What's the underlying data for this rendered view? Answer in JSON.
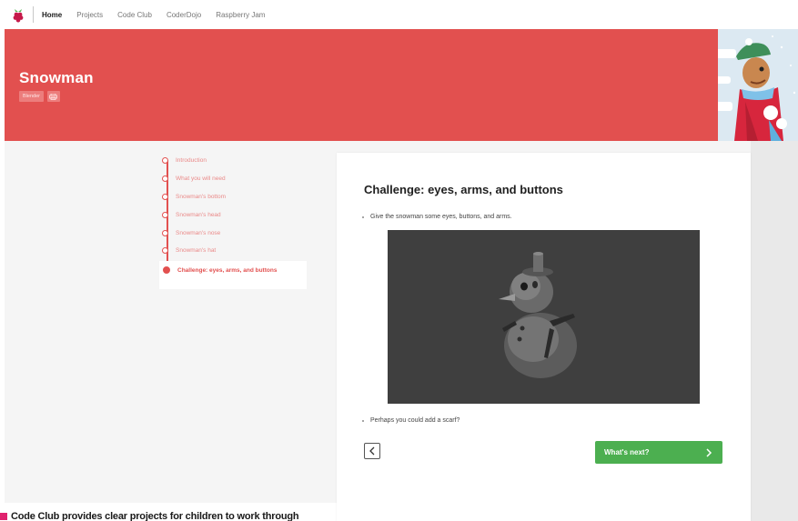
{
  "nav": {
    "logo_icon": "raspberry-pi-logo-icon",
    "links": [
      "Home",
      "Projects",
      "Code Club",
      "CoderDojo",
      "Raspberry Jam"
    ]
  },
  "hero": {
    "title": "Snowman",
    "tag": "Blender",
    "tag_icon": "print-icon",
    "color": "#e2504f"
  },
  "steps": [
    {
      "label": "Introduction"
    },
    {
      "label": "What you will need"
    },
    {
      "label": "Snowman's bottom"
    },
    {
      "label": "Snowman's head"
    },
    {
      "label": "Snowman's nose"
    },
    {
      "label": "Snowman's hat"
    },
    {
      "label": "Challenge: eyes, arms, and buttons",
      "current": true
    }
  ],
  "card": {
    "title": "Challenge: eyes, arms, and buttons",
    "bullet1": "Give the snowman some eyes, buttons, and arms.",
    "bullet2": "Perhaps you could add a scarf?",
    "back_icon": "chevron-left-icon",
    "next_label": "What's next?",
    "next_icon": "chevron-right-icon",
    "next_color": "#4caf50"
  },
  "caption": {
    "text": "Code Club provides clear projects for children to work through",
    "marker_color": "#e0226e"
  }
}
